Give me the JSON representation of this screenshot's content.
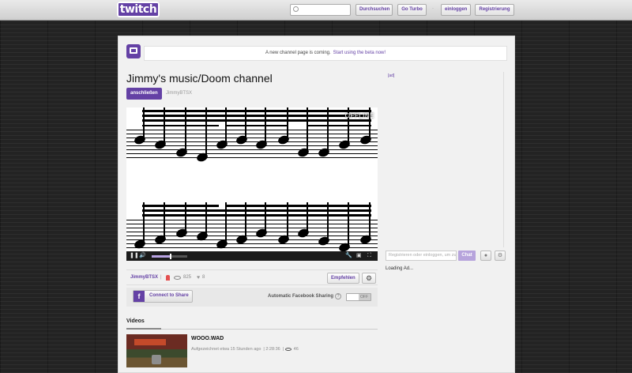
{
  "topbar": {
    "logo": "twitch",
    "search": {
      "value": "",
      "placeholder": ""
    },
    "browse_label": "Durchsuchen",
    "turbo_label": "Go Turbo",
    "separator": "·",
    "login_label": "einloggen",
    "register_label": "Registrierung"
  },
  "notice": {
    "text": "A new channel page is coming.",
    "link": "Start using the beta now!"
  },
  "channel": {
    "title": "Jimmy's music/Doom channel",
    "follow_label": "anschließen",
    "name_small": "JimmyBTSX"
  },
  "player": {
    "offline_text": "OFFLINE",
    "volume_fraction": 0.5
  },
  "info": {
    "name": "JimmyBTSX",
    "separator": "|",
    "views": "825",
    "likes": "8",
    "recommend_label": "Empfehlen"
  },
  "facebook": {
    "icon": "f",
    "connect_label": "Connect to Share",
    "sharing_label": "Automatic Facebook Sharing",
    "help": "?",
    "toggle_state": "OFF"
  },
  "videos": {
    "tab_label": "Videos",
    "items": [
      {
        "title": "WOOO.WAD",
        "recorded": "Aufgezeichnet etwa 15 Stunden ago",
        "duration": "2:28:36",
        "views": "46"
      }
    ]
  },
  "sidebar": {
    "ad_tag": "[ad]",
    "chat_placeholder": "Registrieren oder einloggen, um zu chatten",
    "chat_button": "Chat",
    "loading_ad": "Loading Ad..."
  },
  "colors": {
    "brand": "#6441a5",
    "background": "#232323",
    "panel": "#f1f1f1"
  },
  "icons": [
    "search-icon",
    "channel-icon",
    "play-pause-icon",
    "volume-icon",
    "wrench-icon",
    "popout-icon",
    "fullscreen-icon",
    "user-icon",
    "eye-icon",
    "heart-icon",
    "gear-icon",
    "facebook-icon",
    "help-icon",
    "smiley-icon"
  ]
}
